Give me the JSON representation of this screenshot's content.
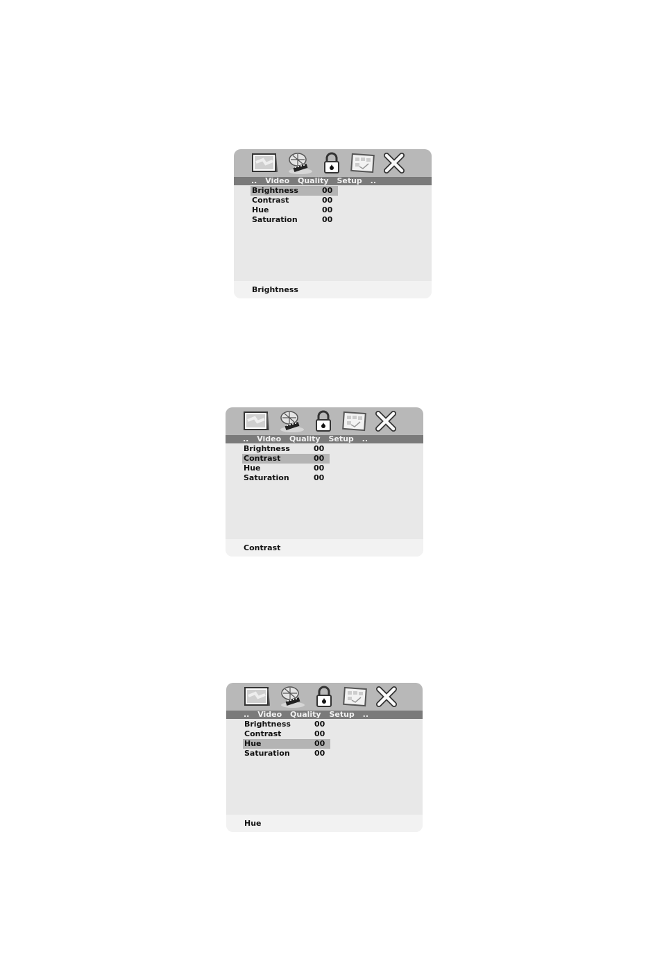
{
  "panels": [
    {
      "icons": [
        "tv-picture-icon",
        "disc-film-icon",
        "lock-icon",
        "grid-setup-icon",
        "close-icon"
      ],
      "breadcrumb": [
        "..",
        "Video",
        "Quality",
        "Setup",
        ".."
      ],
      "rows": [
        {
          "label": "Brightness",
          "value": "00",
          "selected": true
        },
        {
          "label": "Contrast",
          "value": "00",
          "selected": false
        },
        {
          "label": "Hue",
          "value": "00",
          "selected": false
        },
        {
          "label": "Saturation",
          "value": "00",
          "selected": false
        }
      ],
      "status": "Brightness"
    },
    {
      "icons": [
        "tv-picture-icon",
        "disc-film-icon",
        "lock-icon",
        "grid-setup-icon",
        "close-icon"
      ],
      "breadcrumb": [
        "..",
        "Video",
        "Quality",
        "Setup",
        ".."
      ],
      "rows": [
        {
          "label": "Brightness",
          "value": "00",
          "selected": false
        },
        {
          "label": "Contrast",
          "value": "00",
          "selected": true
        },
        {
          "label": "Hue",
          "value": "00",
          "selected": false
        },
        {
          "label": "Saturation",
          "value": "00",
          "selected": false
        }
      ],
      "status": "Contrast"
    },
    {
      "icons": [
        "tv-picture-icon",
        "disc-film-icon",
        "lock-icon",
        "grid-setup-icon",
        "close-icon"
      ],
      "breadcrumb": [
        "..",
        "Video",
        "Quality",
        "Setup",
        ".."
      ],
      "rows": [
        {
          "label": "Brightness",
          "value": "00",
          "selected": false
        },
        {
          "label": "Contrast",
          "value": "00",
          "selected": false
        },
        {
          "label": "Hue",
          "value": "00",
          "selected": true
        },
        {
          "label": "Saturation",
          "value": "00",
          "selected": false
        }
      ],
      "status": "Hue"
    }
  ],
  "colors": {
    "icon_bar": "#b8b8b8",
    "breadcrumb_bar": "#7a7a7a",
    "body": "#e8e8e8",
    "highlight": "#b4b4b4",
    "status_bar": "#f2f2f2"
  }
}
